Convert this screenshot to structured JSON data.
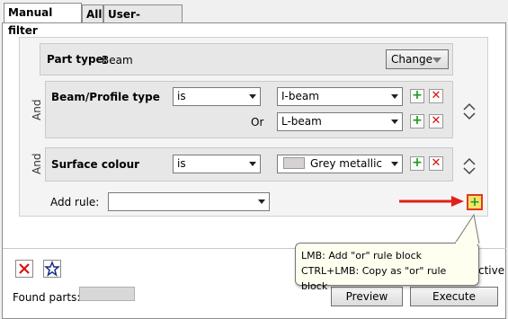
{
  "tabs": [
    {
      "label": "Manual filter"
    },
    {
      "label": "All"
    },
    {
      "label": "User-defined"
    }
  ],
  "part_type": {
    "label": "Part type:",
    "value": "Beam",
    "change_button": "Change"
  },
  "blocks": [
    {
      "operator": "And",
      "label": "Beam/Profile type",
      "condition": "is",
      "values": [
        "I-beam",
        "L-beam"
      ],
      "or_label": "Or"
    },
    {
      "operator": "And",
      "label": "Surface colour",
      "condition": "is",
      "values": [
        "Grey metallic"
      ],
      "swatch_color": "#d8d1d1"
    }
  ],
  "add_rule": {
    "label": "Add rule:",
    "value": ""
  },
  "tooltip": {
    "line1": "LMB: Add \"or\" rule block",
    "line2": "CTRL+LMB: Copy as \"or\" rule block"
  },
  "bottom": {
    "found_parts_label": "Found parts:",
    "preview_button": "Preview",
    "execute_button": "Execute",
    "partial_text": "ctive"
  },
  "colors": {
    "accent_red": "#e0201a",
    "plus_green": "#1e9a1e",
    "highlight_border": "#e03a1a"
  }
}
